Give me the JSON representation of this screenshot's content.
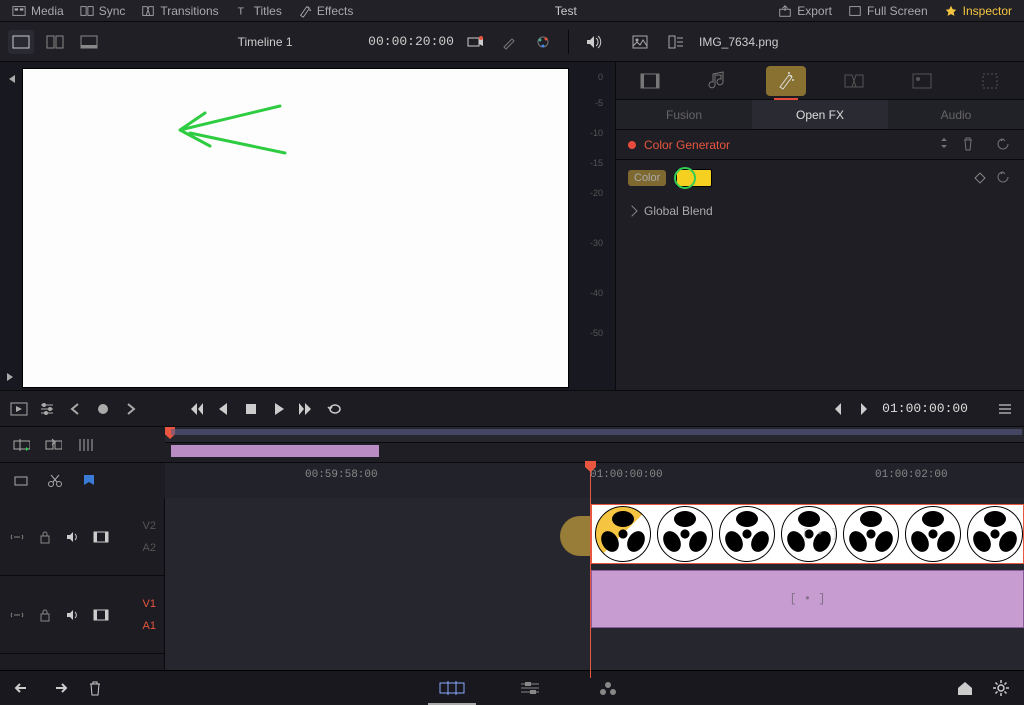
{
  "topbar": {
    "items_left": [
      {
        "label": "Media",
        "icon": "media"
      },
      {
        "label": "Sync",
        "icon": "sync"
      },
      {
        "label": "Transitions",
        "icon": "transitions"
      },
      {
        "label": "Titles",
        "icon": "titles"
      },
      {
        "label": "Effects",
        "icon": "fx"
      }
    ],
    "title": "Test",
    "items_right": [
      {
        "label": "Export",
        "icon": "export"
      },
      {
        "label": "Full Screen",
        "icon": "fullscreen"
      },
      {
        "label": "Inspector",
        "icon": "inspector",
        "active": true
      }
    ]
  },
  "header2": {
    "timeline_name": "Timeline 1",
    "timeline_tc": "00:00:20:00",
    "clip_name": "IMG_7634.png"
  },
  "inspector": {
    "subtabs": [
      "Fusion",
      "Open FX",
      "Audio"
    ],
    "active_subtab": "Open FX",
    "fx_name": "Color Generator",
    "color_label": "Color",
    "color_value": "#f5d020",
    "global_blend": "Global Blend"
  },
  "transport": {
    "tc": "01:00:00:00"
  },
  "ruler": {
    "labels": [
      "00:59:58:00",
      "01:00:00:00",
      "01:00:02:00"
    ]
  },
  "tracks": {
    "pair1": {
      "v": "V2",
      "a": "A2"
    },
    "pair2": {
      "v": "V1",
      "a": "A1"
    }
  },
  "db_ticks": [
    "0",
    "-5",
    "-10",
    "-15",
    "-20",
    "-30",
    "-40",
    "-50"
  ]
}
